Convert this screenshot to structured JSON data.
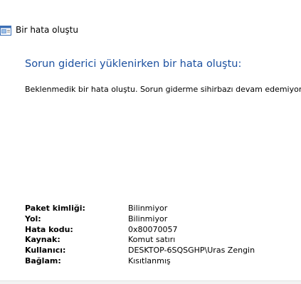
{
  "window": {
    "title": "Bir hata oluştu",
    "icon": "troubleshooter-window-icon"
  },
  "main": {
    "heading": "Sorun giderici yüklenirken bir hata oluştu:",
    "message": "Beklenmedik bir hata oluştu. Sorun giderme sihirbazı devam edemiyor."
  },
  "details": [
    {
      "label": "Paket kimliği:",
      "value": "Bilinmiyor"
    },
    {
      "label": "Yol:",
      "value": "Bilinmiyor"
    },
    {
      "label": "Hata kodu:",
      "value": "0x80070057"
    },
    {
      "label": "Kaynak:",
      "value": "Komut satırı"
    },
    {
      "label": "Kullanıcı:",
      "value": "DESKTOP-6SQSGHP\\Uras Zengin"
    },
    {
      "label": "Bağlam:",
      "value": "Kısıtlanmış"
    }
  ],
  "colors": {
    "heading": "#1a4f9f",
    "background": "#ffffff"
  }
}
